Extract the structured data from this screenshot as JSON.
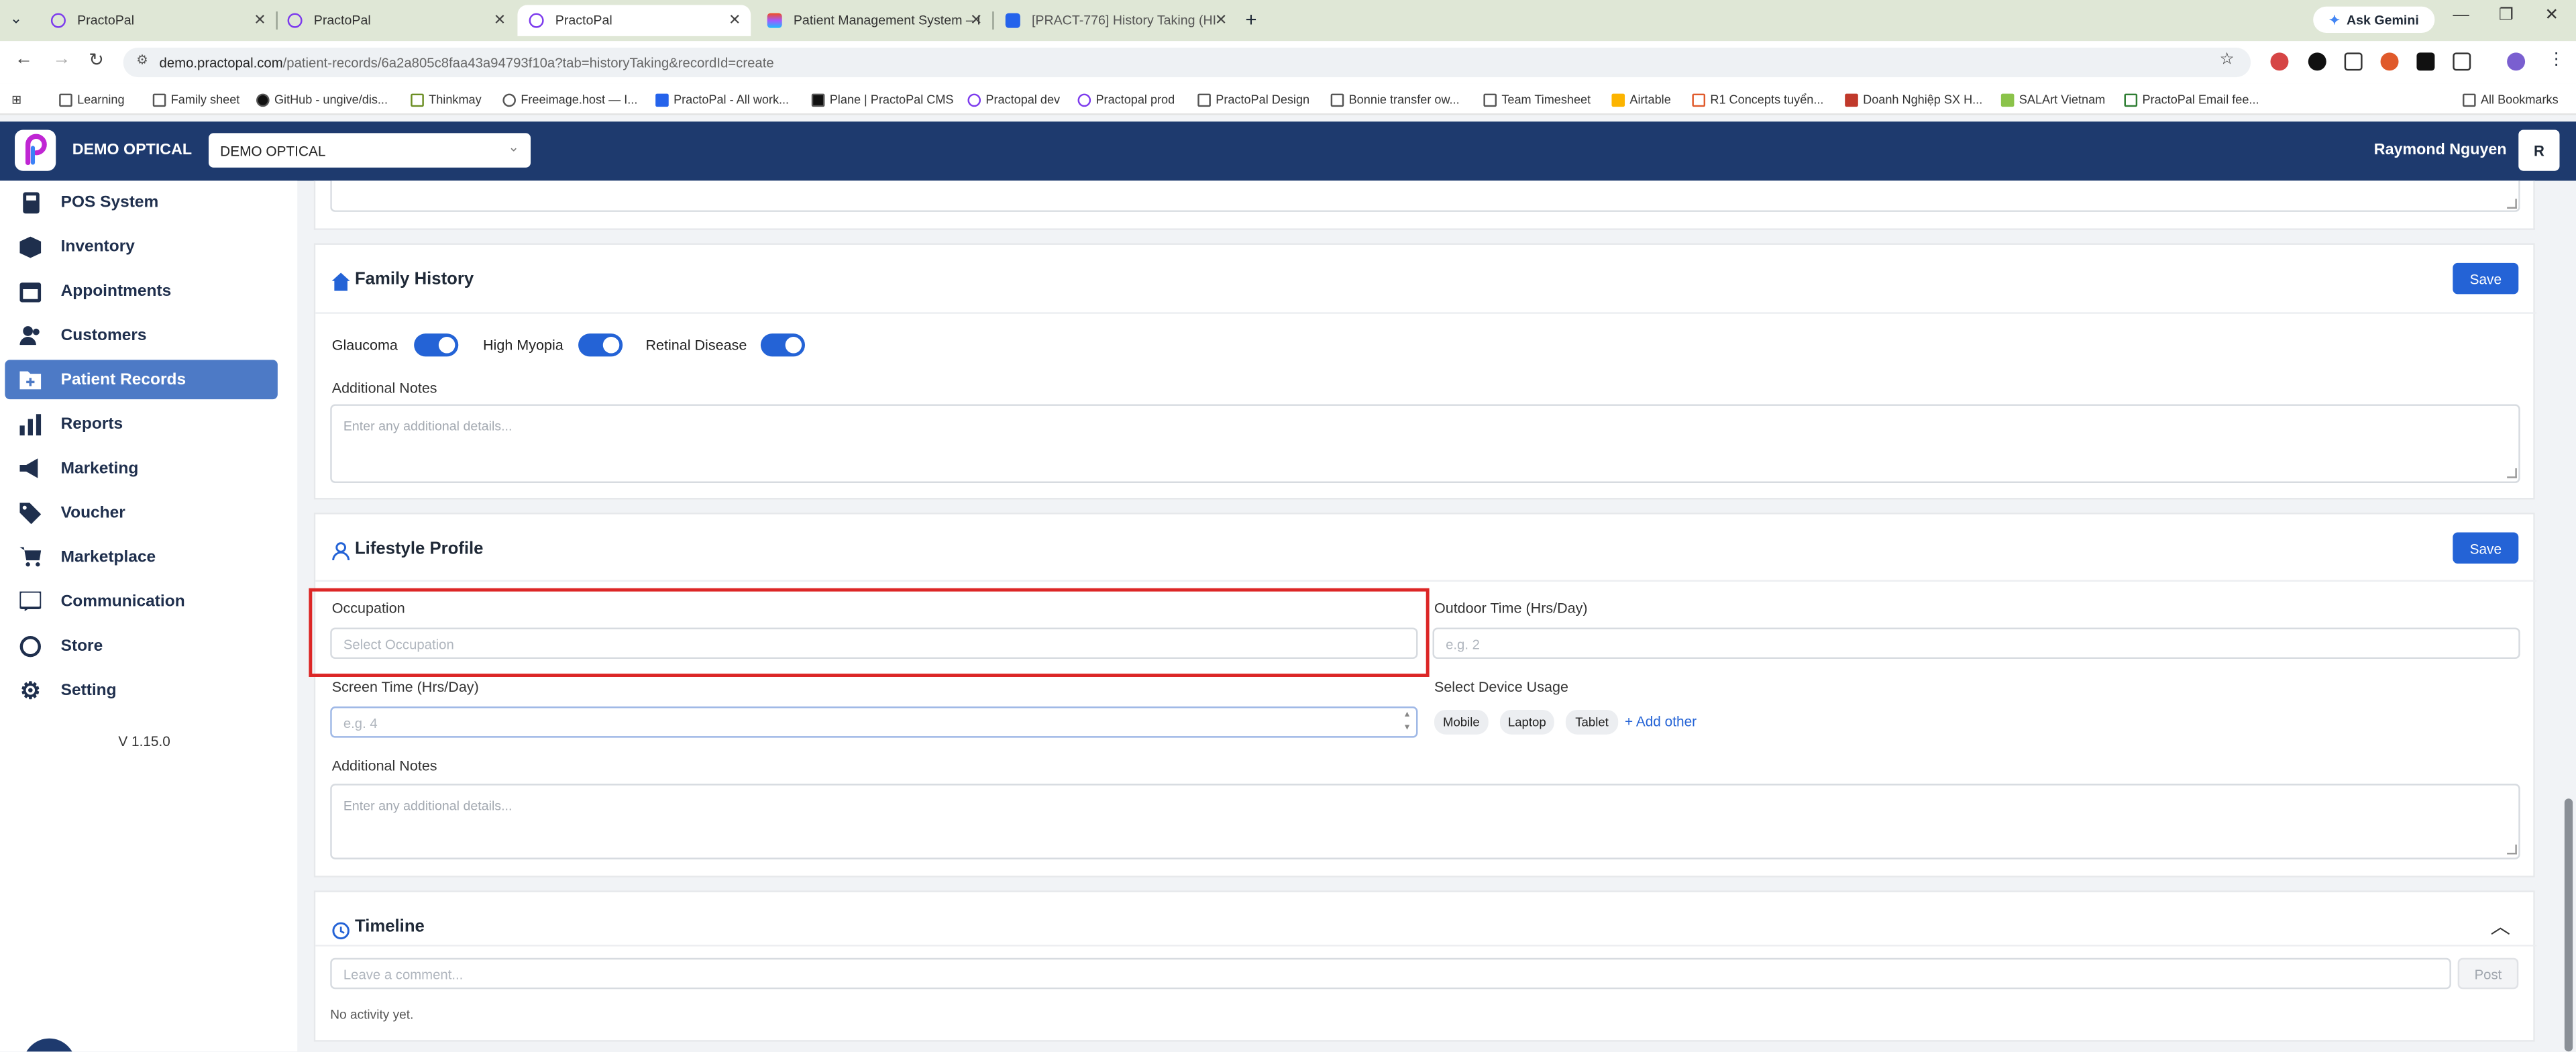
{
  "browser": {
    "tabs": [
      {
        "title": "PractoPal"
      },
      {
        "title": "PractoPal"
      },
      {
        "title": "PractoPal"
      },
      {
        "title": "Patient Management System – I"
      },
      {
        "title": "[PRACT-776] History Taking (HI"
      }
    ],
    "ask_gemini": "Ask Gemini",
    "url_host": "demo.practopal.com",
    "url_path": "/patient-records/6a2a805c8faa43a94793f10a?tab=historyTaking&recordId=create",
    "bookmarks": [
      "Learning",
      "Family sheet",
      "GitHub - ungive/dis...",
      "Thinkmay",
      "Freeimage.host — I...",
      "PractoPal - All work...",
      "Plane | PractoPal CMS",
      "Practopal dev",
      "Practopal prod",
      "PractoPal Design",
      "Bonnie transfer ow...",
      "Team Timesheet",
      "Airtable",
      "R1 Concepts tuyển...",
      "Doanh Nghiệp SX H...",
      "SALArt Vietnam",
      "PractoPal Email fee..."
    ],
    "all_bookmarks": "All Bookmarks"
  },
  "header": {
    "brand": "DEMO OPTICAL",
    "location": "DEMO OPTICAL",
    "user_name": "Raymond Nguyen",
    "avatar_initial": "R"
  },
  "sidebar": {
    "items": [
      {
        "label": "POS System",
        "icon": "calculator-icon"
      },
      {
        "label": "Inventory",
        "icon": "box-icon"
      },
      {
        "label": "Appointments",
        "icon": "calendar-icon"
      },
      {
        "label": "Customers",
        "icon": "users-icon"
      },
      {
        "label": "Patient Records",
        "icon": "folder-plus-icon"
      },
      {
        "label": "Reports",
        "icon": "bar-chart-icon"
      },
      {
        "label": "Marketing",
        "icon": "megaphone-icon"
      },
      {
        "label": "Voucher",
        "icon": "tag-icon"
      },
      {
        "label": "Marketplace",
        "icon": "cart-icon"
      },
      {
        "label": "Communication",
        "icon": "chat-icon"
      },
      {
        "label": "Store",
        "icon": "store-icon"
      },
      {
        "label": "Setting",
        "icon": "gear-icon"
      }
    ],
    "active": "Patient Records",
    "version": "V 1.15.0"
  },
  "family_history": {
    "title": "Family History",
    "save": "Save",
    "toggles": [
      {
        "label": "Glaucoma",
        "on": true
      },
      {
        "label": "High Myopia",
        "on": true
      },
      {
        "label": "Retinal Disease",
        "on": true
      }
    ],
    "notes_label": "Additional Notes",
    "notes_placeholder": "Enter any additional details..."
  },
  "lifestyle": {
    "title": "Lifestyle Profile",
    "save": "Save",
    "occupation_label": "Occupation",
    "occupation_placeholder": "Select Occupation",
    "outdoor_label": "Outdoor Time (Hrs/Day)",
    "outdoor_placeholder": "e.g. 2",
    "screen_label": "Screen Time (Hrs/Day)",
    "screen_placeholder": "e.g. 4",
    "device_label": "Select Device Usage",
    "devices": [
      "Mobile",
      "Laptop",
      "Tablet"
    ],
    "add_other": "+ Add other",
    "notes_label": "Additional Notes",
    "notes_placeholder": "Enter any additional details..."
  },
  "timeline": {
    "title": "Timeline",
    "comment_placeholder": "Leave a comment...",
    "post": "Post",
    "empty": "No activity yet."
  },
  "colors": {
    "primary": "#2463d6",
    "header": "#1e3a6e",
    "sidebar_active": "#4d7ac6",
    "highlight": "#dc2626"
  }
}
